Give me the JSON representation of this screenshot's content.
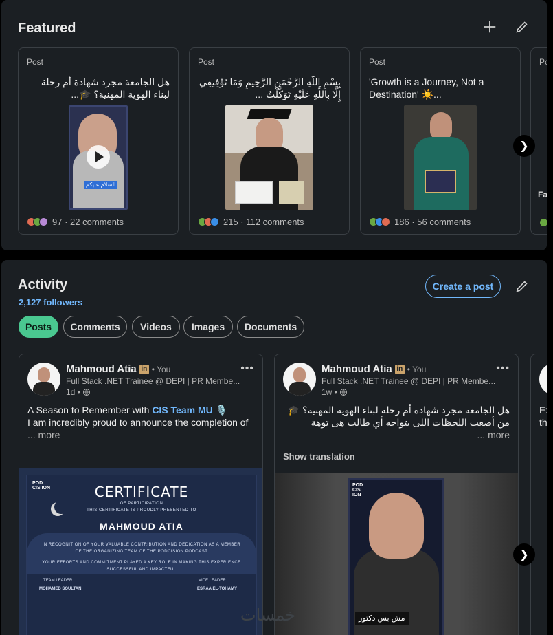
{
  "featured": {
    "title": "Featured",
    "cards": [
      {
        "kind": "Post",
        "text": "هل الجامعة مجرد شهادة أم رحلة لبناء الهوية المهنية؟ 🎓...",
        "dir": "rtl",
        "stats": "97 · 22 comments",
        "video_caption": "السلام عليكم"
      },
      {
        "kind": "Post",
        "text": "بِسْمِ اللَّهِ الرَّحْمَنِ الرَّحِيمِ وَمَا تَوْفِيقِي إِلَّا بِاللَّهِ عَلَيْهِ تَوَكَّلْتُ ...",
        "dir": "rtl",
        "stats": "215 · 112 comments"
      },
      {
        "kind": "Post",
        "text": "'Growth is a Journey, Not a Destination' ☀️...",
        "dir": "ltr",
        "stats": "186 · 56 comments"
      },
      {
        "kind": "Po",
        "text": "",
        "dir": "rtl",
        "stats": "",
        "fa": "Fa"
      }
    ]
  },
  "activity": {
    "title": "Activity",
    "followers": "2,127 followers",
    "create_post": "Create a post",
    "tabs": [
      "Posts",
      "Comments",
      "Videos",
      "Images",
      "Documents"
    ],
    "posts": [
      {
        "name": "Mahmoud Atia",
        "you": "• You",
        "headline": "Full Stack .NET Trainee @ DEPI | PR Membe...",
        "time": "1d •",
        "line1_prefix": "A Season to Remember with ",
        "line1_link": "CIS Team MU",
        "line1_suffix": " 🎙️",
        "line2": "I am incredibly proud to announce the completion of",
        "more": "... more",
        "certificate": {
          "logo": "POD CIS ION",
          "title": "CERTIFICATE",
          "subtitle": "OF PARTICIPATION",
          "presented": "THIS CERTIFICATE IS PROUDLY PRESENTED TO",
          "name": "MAHMOUD ATIA",
          "body1": "IN RECOGNITION OF YOUR VALUABLE CONTRIBUTION AND DEDICATION AS A MEMBER",
          "body2": "OF THE ORGANIZING TEAM OF THE PODCISION PODCAST",
          "body3": "YOUR EFFORTS AND COMMITMENT PLAYED A KEY ROLE IN MAKING THIS EXPERIENCE",
          "body4": "SUCCESSFUL AND IMPACTFUL",
          "left_role": "TEAM LEADER",
          "left_name": "MOHAMED SOULTAN",
          "right_role": "VICE LEADER",
          "right_name": "ESRAA EL-TOHAMY"
        }
      },
      {
        "name": "Mahmoud Atia",
        "you": "• You",
        "headline": "Full Stack .NET Trainee @ DEPI | PR Membe...",
        "time": "1w •",
        "line1": "هل الجامعة مجرد شهادة أم رحلة لبناء الهوية المهنية؟ 🎓",
        "line2": "من أصعب اللحظات اللى بتواجه أي طالب هى توهة",
        "more": "more ...",
        "show_translation": "Show translation",
        "video_caption": "مش بس دكتور"
      }
    ],
    "peek": [
      "Ex",
      "th"
    ]
  },
  "watermark": "خمسات",
  "colors": {
    "accent": "#71b7fb",
    "active_tab": "#4ac890",
    "card_bg": "#1b1f23"
  }
}
